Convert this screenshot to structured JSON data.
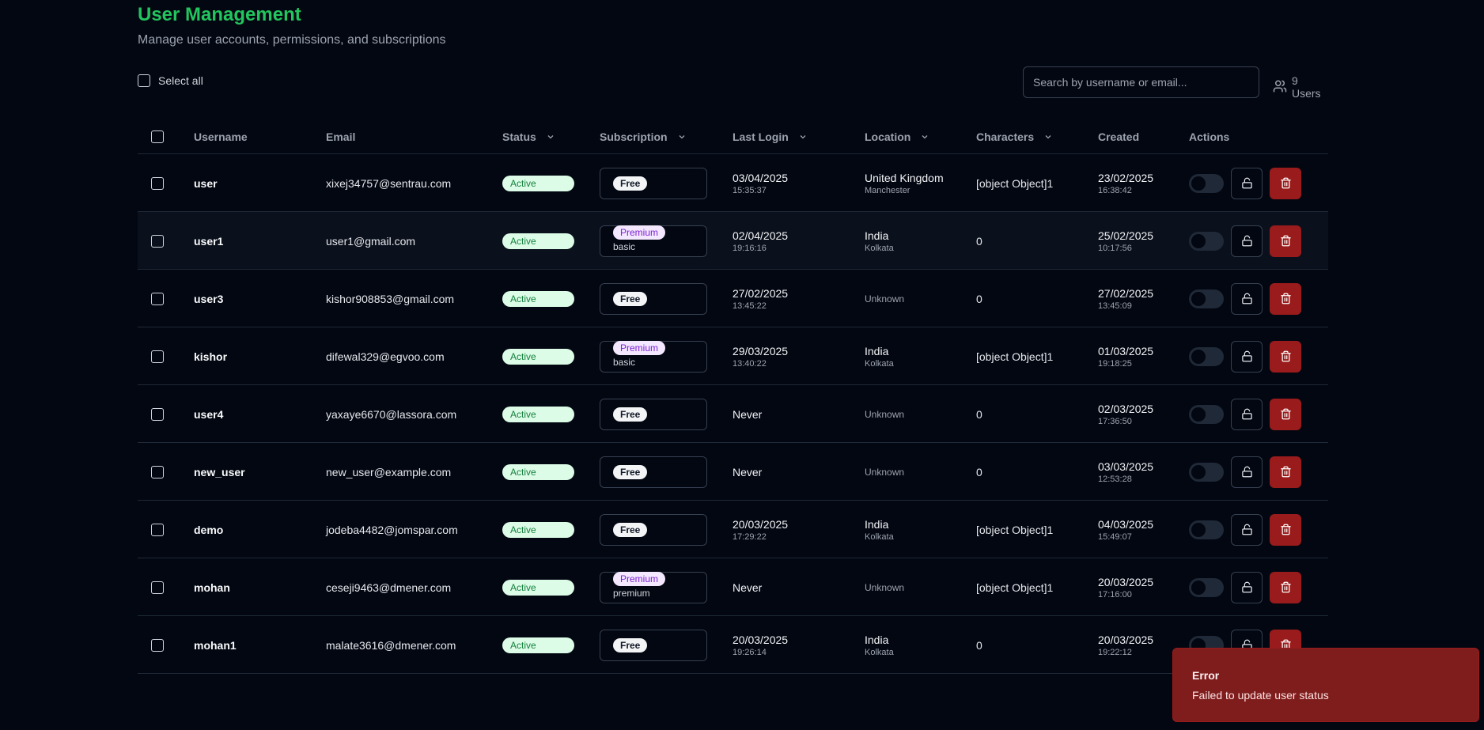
{
  "header": {
    "title": "User Management",
    "subtitle": "Manage user accounts, permissions, and subscriptions"
  },
  "toolbar": {
    "select_all_label": "Select all",
    "search_placeholder": "Search by username or email...",
    "user_count": "9 Users"
  },
  "table": {
    "columns": {
      "username": "Username",
      "email": "Email",
      "status": "Status",
      "subscription": "Subscription",
      "last_login": "Last Login",
      "location": "Location",
      "characters": "Characters",
      "created": "Created",
      "actions": "Actions"
    },
    "rows": [
      {
        "username": "user",
        "email": "xixej34757@sentrau.com",
        "status": "Active",
        "sub_badge": "Free",
        "sub_type": "free",
        "sub_tier": "",
        "login_date": "03/04/2025",
        "login_time": "15:35:37",
        "loc_country": "United Kingdom",
        "loc_city": "Manchester",
        "characters": "[object Object]1",
        "created_date": "23/02/2025",
        "created_time": "16:38:42"
      },
      {
        "username": "user1",
        "email": "user1@gmail.com",
        "status": "Active",
        "sub_badge": "Premium",
        "sub_type": "premium",
        "sub_tier": "basic",
        "login_date": "02/04/2025",
        "login_time": "19:16:16",
        "loc_country": "India",
        "loc_city": "Kolkata",
        "characters": "0",
        "created_date": "25/02/2025",
        "created_time": "10:17:56"
      },
      {
        "username": "user3",
        "email": "kishor908853@gmail.com",
        "status": "Active",
        "sub_badge": "Free",
        "sub_type": "free",
        "sub_tier": "",
        "login_date": "27/02/2025",
        "login_time": "13:45:22",
        "loc_country": "",
        "loc_city": "",
        "loc_unknown": "Unknown",
        "characters": "0",
        "created_date": "27/02/2025",
        "created_time": "13:45:09"
      },
      {
        "username": "kishor",
        "email": "difewal329@egvoo.com",
        "status": "Active",
        "sub_badge": "Premium",
        "sub_type": "premium",
        "sub_tier": "basic",
        "login_date": "29/03/2025",
        "login_time": "13:40:22",
        "loc_country": "India",
        "loc_city": "Kolkata",
        "characters": "[object Object]1",
        "created_date": "01/03/2025",
        "created_time": "19:18:25"
      },
      {
        "username": "user4",
        "email": "yaxaye6670@lassora.com",
        "status": "Active",
        "sub_badge": "Free",
        "sub_type": "free",
        "sub_tier": "",
        "login_date": "Never",
        "login_time": "",
        "loc_country": "",
        "loc_city": "",
        "loc_unknown": "Unknown",
        "characters": "0",
        "created_date": "02/03/2025",
        "created_time": "17:36:50"
      },
      {
        "username": "new_user",
        "email": "new_user@example.com",
        "status": "Active",
        "sub_badge": "Free",
        "sub_type": "free",
        "sub_tier": "",
        "login_date": "Never",
        "login_time": "",
        "loc_country": "",
        "loc_city": "",
        "loc_unknown": "Unknown",
        "characters": "0",
        "created_date": "03/03/2025",
        "created_time": "12:53:28"
      },
      {
        "username": "demo",
        "email": "jodeba4482@jomspar.com",
        "status": "Active",
        "sub_badge": "Free",
        "sub_type": "free",
        "sub_tier": "",
        "login_date": "20/03/2025",
        "login_time": "17:29:22",
        "loc_country": "India",
        "loc_city": "Kolkata",
        "characters": "[object Object]1",
        "created_date": "04/03/2025",
        "created_time": "15:49:07"
      },
      {
        "username": "mohan",
        "email": "ceseji9463@dmener.com",
        "status": "Active",
        "sub_badge": "Premium",
        "sub_type": "premium",
        "sub_tier": "premium",
        "login_date": "Never",
        "login_time": "",
        "loc_country": "",
        "loc_city": "",
        "loc_unknown": "Unknown",
        "characters": "[object Object]1",
        "created_date": "20/03/2025",
        "created_time": "17:16:00"
      },
      {
        "username": "mohan1",
        "email": "malate3616@dmener.com",
        "status": "Active",
        "sub_badge": "Free",
        "sub_type": "free",
        "sub_tier": "",
        "login_date": "20/03/2025",
        "login_time": "19:26:14",
        "loc_country": "India",
        "loc_city": "Kolkata",
        "characters": "0",
        "created_date": "20/03/2025",
        "created_time": "19:22:12"
      }
    ]
  },
  "toast": {
    "title": "Error",
    "message": "Failed to update user status"
  },
  "colors": {
    "accent": "#22c55e",
    "background": "#030712",
    "status_active_bg": "#dcfce7",
    "premium_badge_bg": "#f3e8ff",
    "delete_button": "#991b1b",
    "toast_bg": "#7f1d1d"
  },
  "icons": {
    "users": "users-icon",
    "chevron": "chevron-down-icon",
    "lock": "unlock-icon",
    "delete": "trash-icon"
  }
}
